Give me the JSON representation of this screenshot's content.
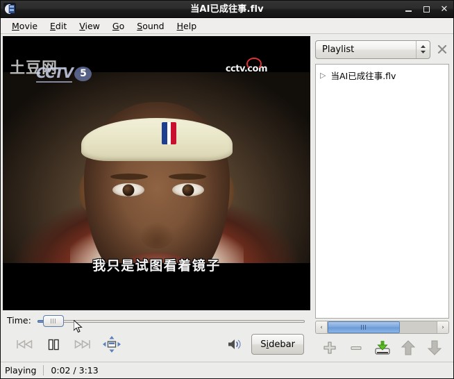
{
  "window": {
    "title": "当AI已成往事.flv",
    "app_icon": "film-reel-icon",
    "controls": {
      "minimize": "minimize-icon",
      "maximize": "maximize-icon",
      "close": "close-icon"
    }
  },
  "menubar": {
    "items": [
      {
        "label": "Movie",
        "mnemonic": "M",
        "rest": "ovie"
      },
      {
        "label": "Edit",
        "mnemonic": "E",
        "rest": "dit"
      },
      {
        "label": "View",
        "mnemonic": "V",
        "rest": "iew"
      },
      {
        "label": "Go",
        "mnemonic": "G",
        "rest": "o"
      },
      {
        "label": "Sound",
        "mnemonic": "S",
        "rest": "ound"
      },
      {
        "label": "Help",
        "mnemonic": "H",
        "rest": "elp"
      }
    ]
  },
  "video": {
    "watermark_tudou": "土豆网",
    "watermark_cctv": "CCTV",
    "watermark_channel": "5",
    "watermark_site": "cctv.com",
    "subtitle": "我只是试图看着镜子"
  },
  "controls": {
    "time_label": "Time:",
    "slider_position_percent": 1,
    "buttons": {
      "previous": "previous-chapter-icon",
      "pause": "pause-icon",
      "next": "next-chapter-icon",
      "fullscreen": "fullscreen-icon",
      "volume": "volume-icon"
    },
    "sidebar_button": {
      "prefix": "S",
      "mnemonic": "i",
      "suffix": "debar",
      "label": "Sidebar"
    }
  },
  "sidebar": {
    "selected_view": "Playlist",
    "close_label": "✕",
    "items": [
      {
        "label": "当AI已成往事.flv",
        "marker": "▷"
      }
    ],
    "scrollbar": {
      "left_arrow": "‹",
      "right_arrow": "›",
      "thumb_percent": 66
    },
    "buttons": [
      {
        "name": "add-to-playlist-button",
        "icon": "plus-icon"
      },
      {
        "name": "remove-from-playlist-button",
        "icon": "minus-icon"
      },
      {
        "name": "save-playlist-button",
        "icon": "save-to-disk-icon"
      },
      {
        "name": "move-up-button",
        "icon": "arrow-up-icon"
      },
      {
        "name": "move-down-button",
        "icon": "arrow-down-icon"
      }
    ]
  },
  "statusbar": {
    "state": "Playing",
    "time": "0:02 / 3:13"
  },
  "colors": {
    "titlebar": "#2a2a2a",
    "chrome": "#ececeb",
    "accent_blue": "#7ba6dd",
    "list_bg": "#ffffff"
  }
}
